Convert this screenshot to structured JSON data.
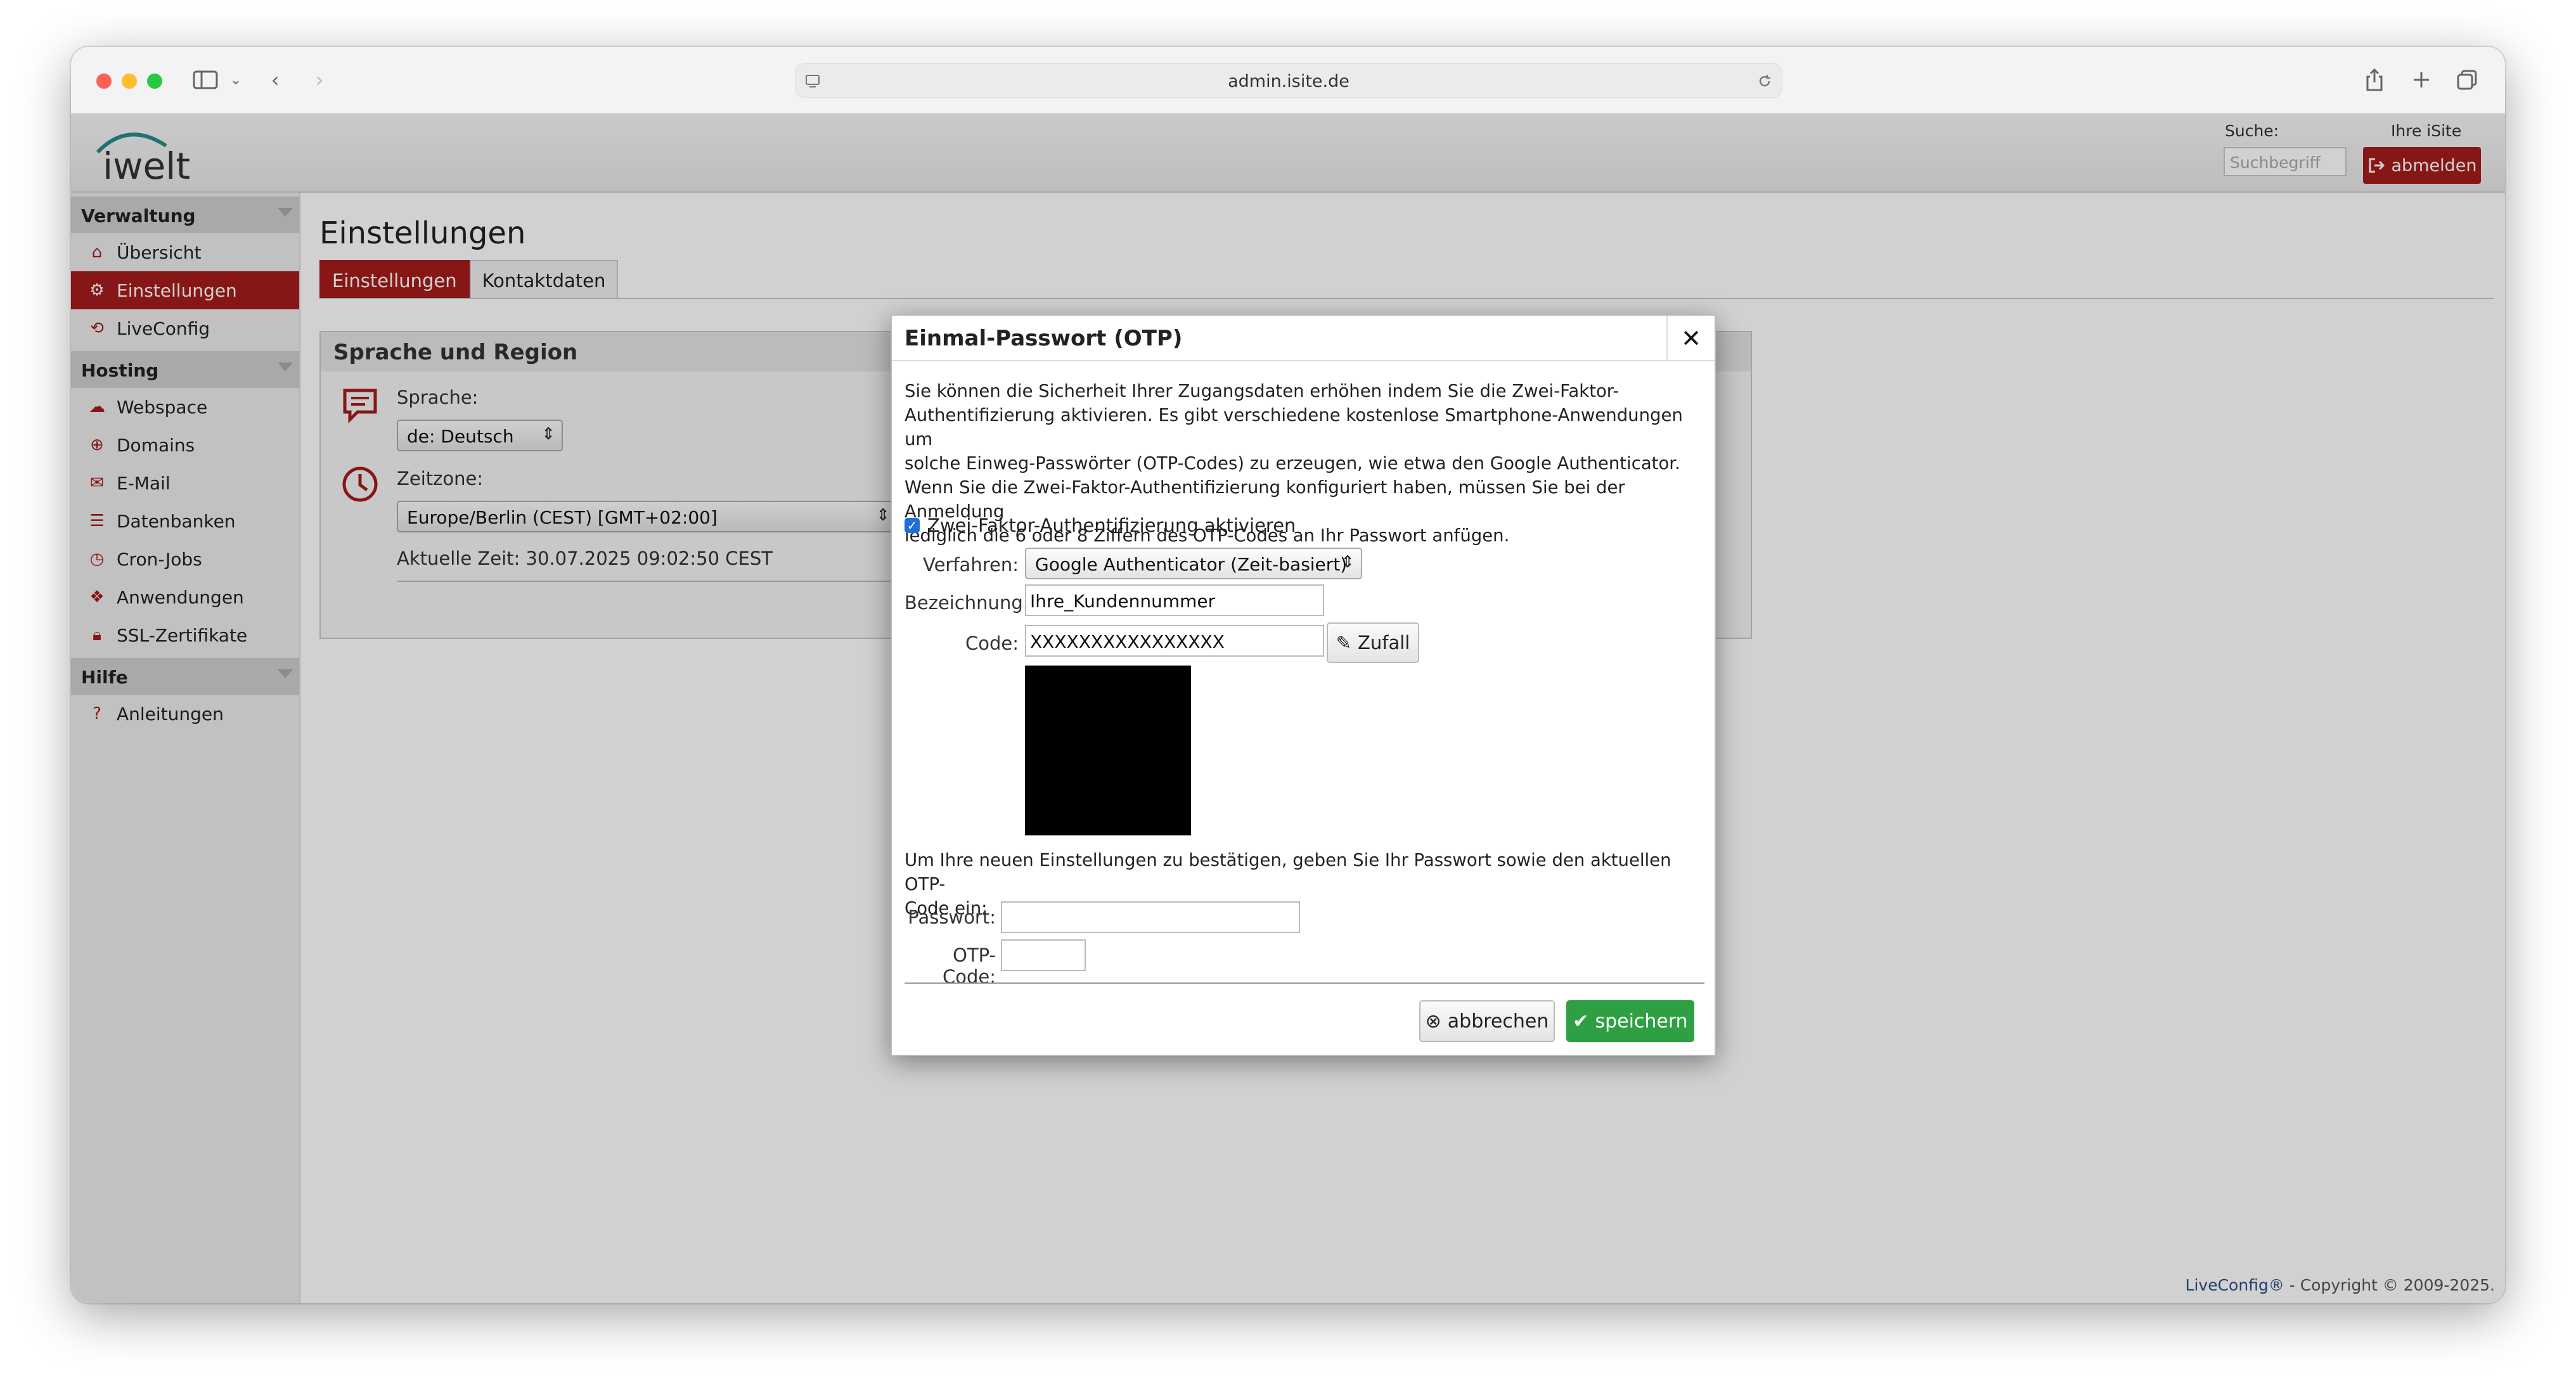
{
  "browser": {
    "url": "admin.isite.de"
  },
  "header": {
    "logo_text": "iwelt",
    "search_label": "Suche:",
    "search_placeholder": "Suchbegriff",
    "account_label": "Ihre iSite",
    "logout_label": "abmelden"
  },
  "sidebar": {
    "sections": [
      {
        "title": "Verwaltung",
        "items": [
          {
            "label": "Übersicht",
            "icon": "home-icon"
          },
          {
            "label": "Einstellungen",
            "icon": "gear-icon",
            "active": true
          },
          {
            "label": "LiveConfig",
            "icon": "liveconfig-icon"
          }
        ]
      },
      {
        "title": "Hosting",
        "items": [
          {
            "label": "Webspace",
            "icon": "cloud-icon"
          },
          {
            "label": "Domains",
            "icon": "globe-icon"
          },
          {
            "label": "E-Mail",
            "icon": "mail-icon"
          },
          {
            "label": "Datenbanken",
            "icon": "database-icon"
          },
          {
            "label": "Cron-Jobs",
            "icon": "clock-icon"
          },
          {
            "label": "Anwendungen",
            "icon": "package-icon"
          },
          {
            "label": "SSL-Zertifikate",
            "icon": "lock-icon"
          }
        ]
      },
      {
        "title": "Hilfe",
        "items": [
          {
            "label": "Anleitungen",
            "icon": "question-icon"
          }
        ]
      }
    ]
  },
  "main": {
    "title": "Einstellungen",
    "tabs": [
      "Einstellungen",
      "Kontaktdaten"
    ],
    "region_box": {
      "title": "Sprache und Region",
      "language_label": "Sprache:",
      "language_value": "de: Deutsch",
      "timezone_label": "Zeitzone:",
      "timezone_value": "Europe/Berlin (CEST) [GMT+02:00]",
      "current_time": "Aktuelle Zeit: 30.07.2025 09:02:50 CEST"
    }
  },
  "dialog": {
    "title": "Einmal-Passwort (OTP)",
    "intro_lines": [
      "Sie können die Sicherheit Ihrer Zugangsdaten erhöhen indem Sie die Zwei-Faktor-",
      "Authentifizierung aktivieren. Es gibt verschiedene kostenlose Smartphone-Anwendungen um",
      "solche Einweg-Passwörter (OTP-Codes) zu erzeugen, wie etwa den Google Authenticator.",
      "Wenn Sie die Zwei-Faktor-Authentifizierung konfiguriert haben, müssen Sie bei der Anmeldung",
      "lediglich die 6 oder 8 Ziffern des OTP-Codes an Ihr Passwort anfügen."
    ],
    "enable_2fa_label": "Zwei-Faktor-Authentifizierung aktivieren",
    "enable_2fa_checked": true,
    "method_label": "Verfahren:",
    "method_value": "Google Authenticator (Zeit-basiert)",
    "name_label": "Bezeichnung:",
    "name_value": "Ihre_Kundennummer",
    "code_label": "Code:",
    "code_value": "XXXXXXXXXXXXXXXX",
    "random_label": "Zufall",
    "confirm_lines": [
      "Um Ihre neuen Einstellungen zu bestätigen, geben Sie Ihr Passwort sowie den aktuellen OTP-",
      "Code ein:"
    ],
    "password_label": "Passwort:",
    "password_value": "",
    "otp_label": "OTP-Code:",
    "otp_value": "",
    "cancel_label": "abbrechen",
    "save_label": "speichern"
  },
  "footer": {
    "brand": "LiveConfig®",
    "copyright": " - Copyright © 2009-2025."
  },
  "colors": {
    "accent": "#a51c1c",
    "save_green": "#2ea043"
  }
}
